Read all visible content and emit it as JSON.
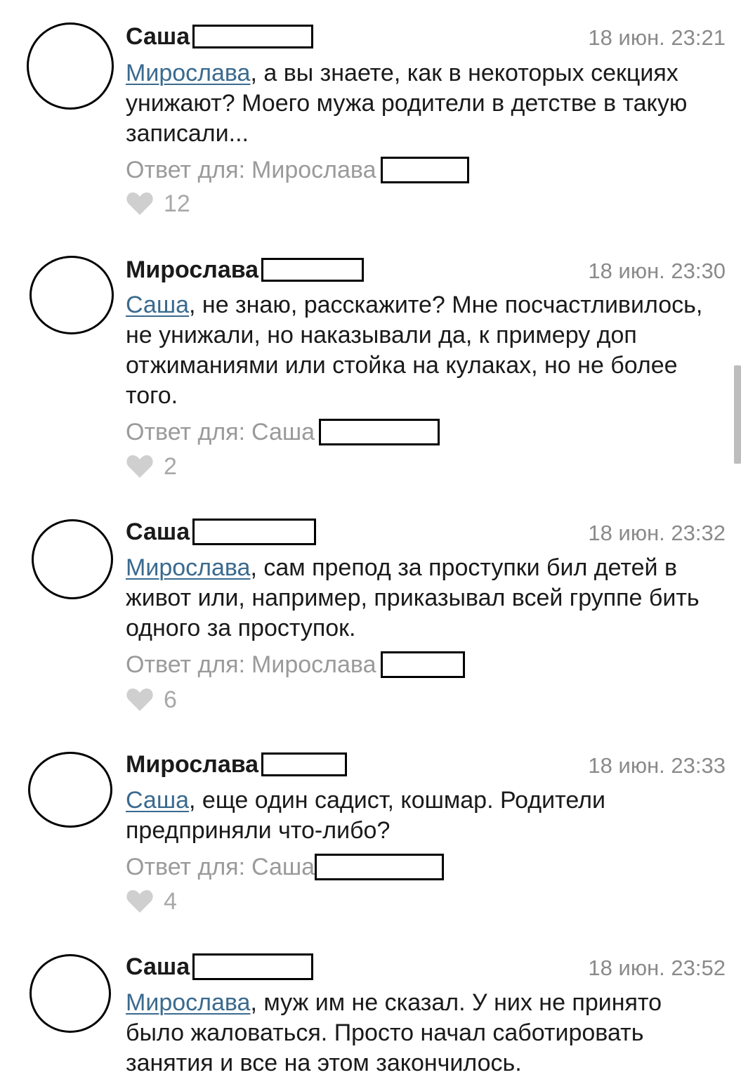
{
  "comments": [
    {
      "author": "Саша",
      "time": "18 июн. 23:21",
      "mention": "Мирослава",
      "text": ", а вы знаете, как в некоторых секциях унижают? Моего мужа родители в детстве в такую записали...",
      "reply_prefix": "Ответ для: ",
      "reply_to": "Мирослава",
      "likes": "12"
    },
    {
      "author": "Мирослава",
      "time": "18 июн. 23:30",
      "mention": "Саша",
      "text": ", не знаю, расскажите? Мне посчастливилось, не унижали, но наказывали да, к примеру доп отжиманиями или стойка на кулаках, но не более того.",
      "reply_prefix": "Ответ для: ",
      "reply_to": "Саша",
      "likes": "2"
    },
    {
      "author": "Саша",
      "time": "18 июн. 23:32",
      "mention": "Мирослава",
      "text": ", сам препод за проступки бил детей в живот или, например, приказывал всей группе бить одного за проступок.",
      "reply_prefix": "Ответ для: ",
      "reply_to": "Мирослава",
      "likes": "6"
    },
    {
      "author": "Мирослава",
      "time": "18 июн. 23:33",
      "mention": "Саша",
      "text": ", еще один садист, кошмар. Родители предприняли что-либо?",
      "reply_prefix": "Ответ для: ",
      "reply_to": "Саша",
      "likes": "4"
    },
    {
      "author": "Саша",
      "time": "18 июн. 23:52",
      "mention": "Мирослава",
      "text": ", муж им не сказал. У них не принято было жаловаться. Просто начал саботировать занятия и все на этом закончилось."
    }
  ],
  "icons": {
    "like": "heart-icon"
  },
  "colors": {
    "mention": "#3a6a8f",
    "meta": "#8a8a8a",
    "heart": "#cfcfcf"
  }
}
